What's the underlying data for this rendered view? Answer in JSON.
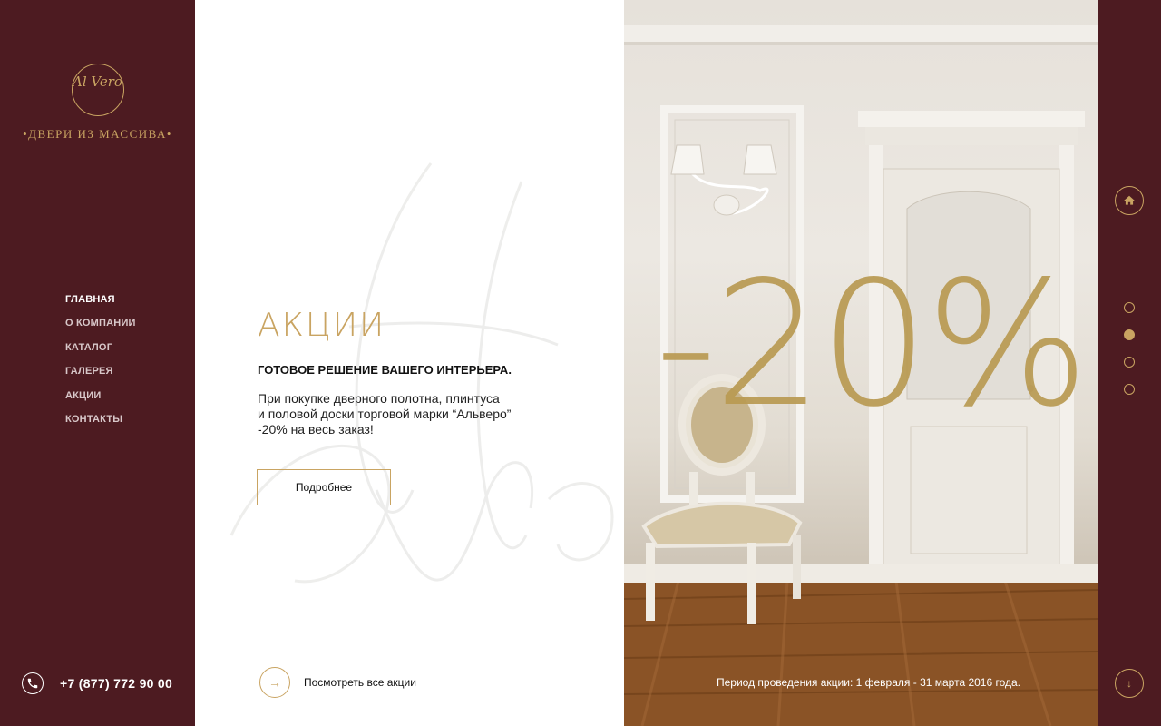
{
  "logo": {
    "script": "Al Vero",
    "tagline": "•ДВЕРИ ИЗ МАССИВА•"
  },
  "nav": {
    "items": [
      {
        "label": "ГЛАВНАЯ",
        "active": true
      },
      {
        "label": "О КОМПАНИИ",
        "active": false
      },
      {
        "label": "КАТАЛОГ",
        "active": false
      },
      {
        "label": "ГАЛЕРЕЯ",
        "active": false
      },
      {
        "label": "АКЦИИ",
        "active": false
      },
      {
        "label": "КОНТАКТЫ",
        "active": false
      }
    ]
  },
  "contact": {
    "phone": "+7 (877) 772 90 00",
    "icon": "phone-icon"
  },
  "promo": {
    "title": "АКЦИИ",
    "subtitle": "ГОТОВОЕ РЕШЕНИЕ ВАШЕГО ИНТЕРЬЕРА.",
    "description_lines": [
      "При покупке дверного полотна, плинтуса",
      "и половой доски торговой марки “Альверо”",
      "-20% на весь заказ!"
    ],
    "more_button": "Подробнее",
    "all_link": "Посмотреть все акции",
    "discount": "-20%",
    "period": "Период проведения акции: 1 февраля - 31 марта 2016 года."
  },
  "slider": {
    "dots": [
      false,
      true,
      false,
      false
    ]
  },
  "colors": {
    "burgundy": "#4d1b21",
    "gold": "#c9a462",
    "discount_gold": "#b99a52"
  }
}
